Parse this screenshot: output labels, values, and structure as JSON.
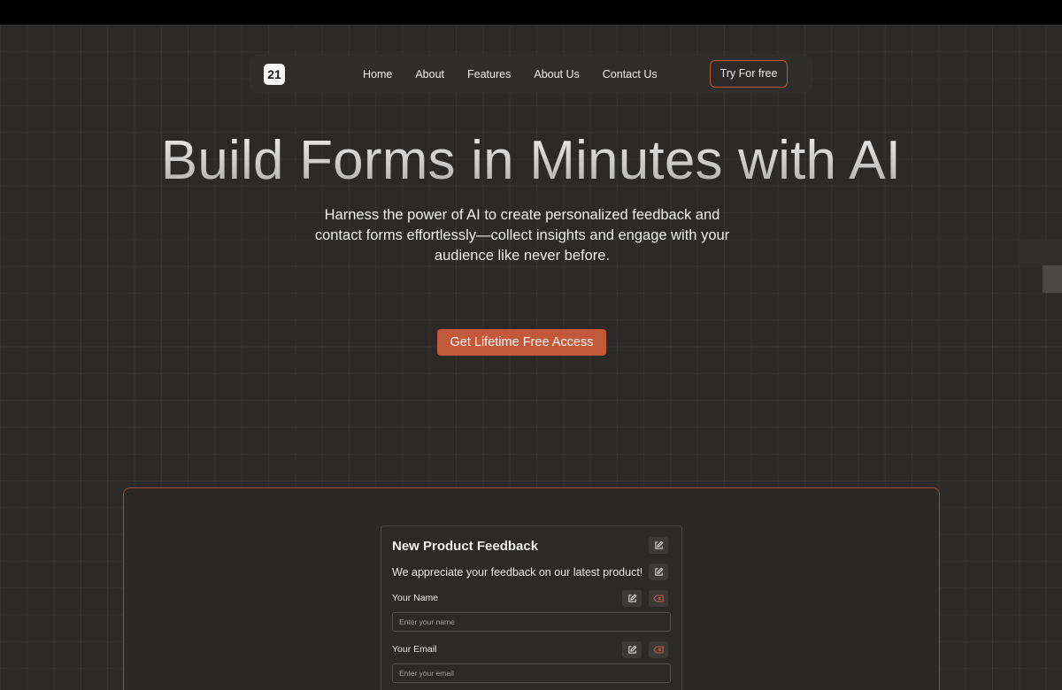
{
  "nav": {
    "logo_text": "21",
    "links": [
      "Home",
      "About",
      "Features",
      "About Us",
      "Contact Us"
    ],
    "cta_label": "Try For free"
  },
  "hero": {
    "title": "Build Forms in Minutes with AI",
    "subtitle": "Harness the power of AI to create personalized feedback and contact forms effortlessly—collect insights and engage with your audience like never before.",
    "cta_label": "Get Lifetime Free Access"
  },
  "form": {
    "title": "New Product Feedback",
    "description": "We appreciate your feedback on our latest product!",
    "fields": [
      {
        "label": "Your Name",
        "placeholder": "Enter your name"
      },
      {
        "label": "Your Email",
        "placeholder": "Enter your email"
      }
    ]
  },
  "icons": {
    "edit": "pencil-square-icon",
    "delete": "backspace-icon"
  },
  "colors": {
    "accent": "#c2593a",
    "background": "#2b2a28",
    "topbar": "#000000"
  }
}
